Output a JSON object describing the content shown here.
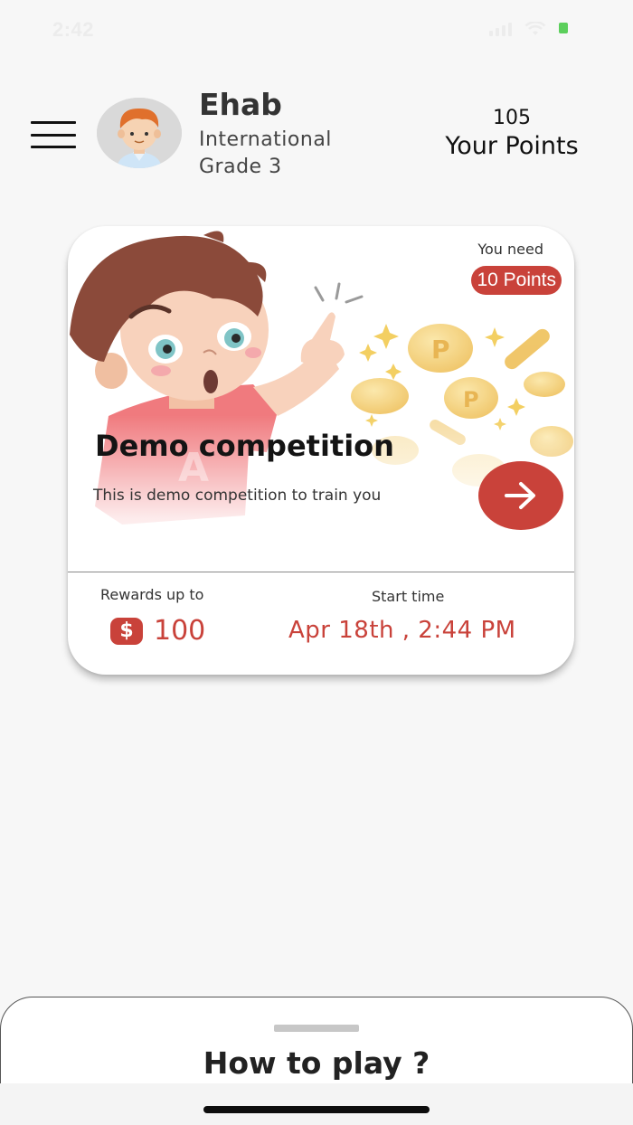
{
  "status_bar": {
    "time": "2:42"
  },
  "header": {
    "user_name": "Ehab",
    "school": "International",
    "grade": "Grade 3",
    "points_value": "105",
    "points_label": "Your Points"
  },
  "competition": {
    "need_label": "You need",
    "need_points": "10 Points",
    "title": "Demo competition",
    "description": "This is demo competition to train you",
    "rewards_label": "Rewards up to",
    "reward_value": "100",
    "currency_symbol": "$",
    "start_label": "Start time",
    "start_value": "Apr 18th , 2:44 PM",
    "accent_color": "#c9423a"
  },
  "bottom_sheet": {
    "title": "How to play ?"
  },
  "icons": [
    "menu-icon",
    "avatar-icon",
    "arrow-right-icon",
    "dollar-icon",
    "signal-icon",
    "wifi-icon",
    "battery-icon",
    "location-arrow-icon"
  ]
}
